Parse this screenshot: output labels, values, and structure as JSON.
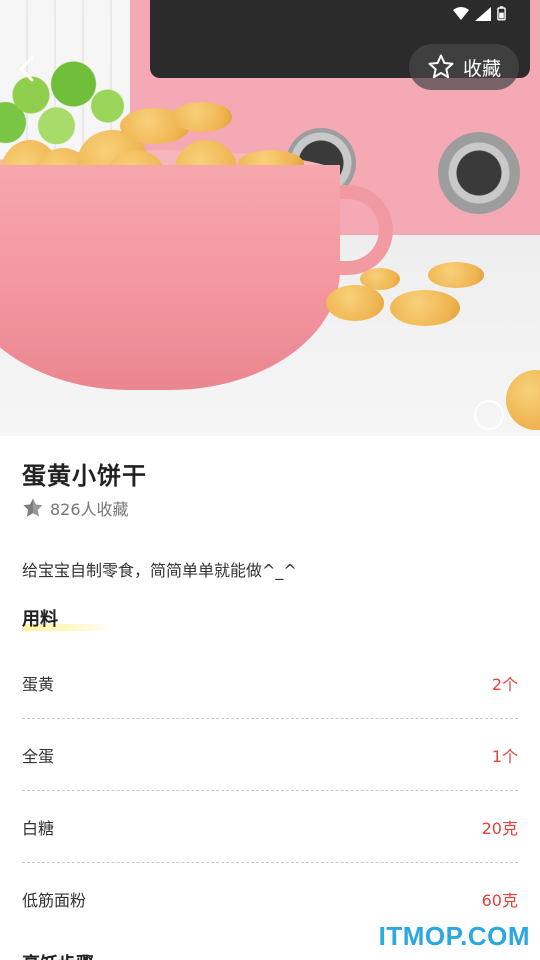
{
  "header": {
    "favorite_label": "收藏"
  },
  "recipe": {
    "title": "蛋黄小饼干",
    "favorites_count": "826人收藏",
    "description": "给宝宝自制零食，简简单单就能做^_^"
  },
  "ingredients_section": {
    "title": "用料",
    "items": [
      {
        "name": "蛋黄",
        "quantity": "2个"
      },
      {
        "name": "全蛋",
        "quantity": "1个"
      },
      {
        "name": "白糖",
        "quantity": "20克"
      },
      {
        "name": "低筋面粉",
        "quantity": "60克"
      }
    ]
  },
  "next_section": {
    "title": "烹饪步骤"
  },
  "watermark": "ITMOP.COM",
  "colors": {
    "accent_red": "#e8403a",
    "underline_yellow": "#fff3a6",
    "watermark_blue": "#2aa8e0"
  }
}
